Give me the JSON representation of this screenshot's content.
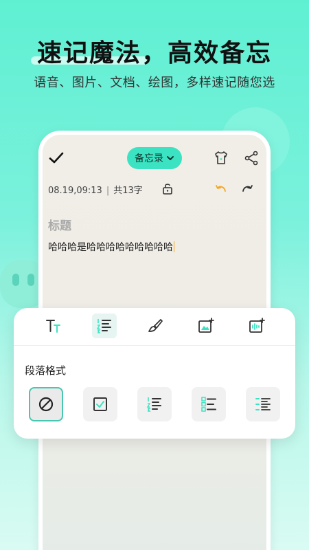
{
  "promo": {
    "headline": "速记魔法，高效备忘",
    "subline": "语音、图片、文档、绘图，多样速记随您选"
  },
  "editor": {
    "memo_label": "备忘录",
    "meta_date": "08.19,09:13",
    "meta_sep": "|",
    "meta_count": "共13字",
    "note_title": "标题",
    "note_body": "哈哈哈是哈哈哈哈哈哈哈哈哈"
  },
  "panel": {
    "section_label": "段落格式",
    "tabs": [
      "text-style-icon",
      "ordered-list-icon",
      "brush-icon",
      "image-insert-icon",
      "audio-insert-icon"
    ],
    "active_tab": "ordered-list-icon",
    "formats": [
      "none-icon",
      "checkbox-icon",
      "numbered-list-icon",
      "square-bullet-list-icon",
      "dash-list-icon"
    ],
    "active_format": "none-icon"
  },
  "colors": {
    "accent": "#3be3c2",
    "accent_border": "#46c7b1",
    "undo": "#f5a623"
  }
}
